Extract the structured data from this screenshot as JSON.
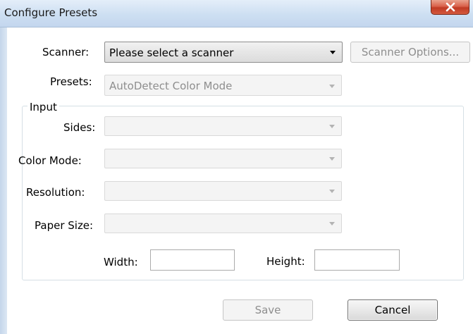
{
  "window": {
    "title": "Configure Presets"
  },
  "scanner": {
    "label": "Scanner:",
    "value": "Please select a scanner",
    "options_button": "Scanner Options..."
  },
  "presets": {
    "label": "Presets:",
    "value": "AutoDetect Color Mode"
  },
  "input_group": {
    "legend": "Input",
    "sides_label": "Sides:",
    "sides_value": "",
    "color_mode_label": "Color Mode:",
    "color_mode_value": "",
    "resolution_label": "Resolution:",
    "resolution_value": "",
    "paper_size_label": "Paper Size:",
    "paper_size_value": "",
    "width_label": "Width:",
    "width_value": "",
    "height_label": "Height:",
    "height_value": ""
  },
  "buttons": {
    "save": "Save",
    "cancel": "Cancel"
  },
  "icons": {
    "close": "close-icon",
    "dropdown": "chevron-down-icon"
  },
  "colors": {
    "close_button": "#c9462d",
    "title_bar": "#cddff2",
    "disabled_text": "#8e8e8e"
  }
}
